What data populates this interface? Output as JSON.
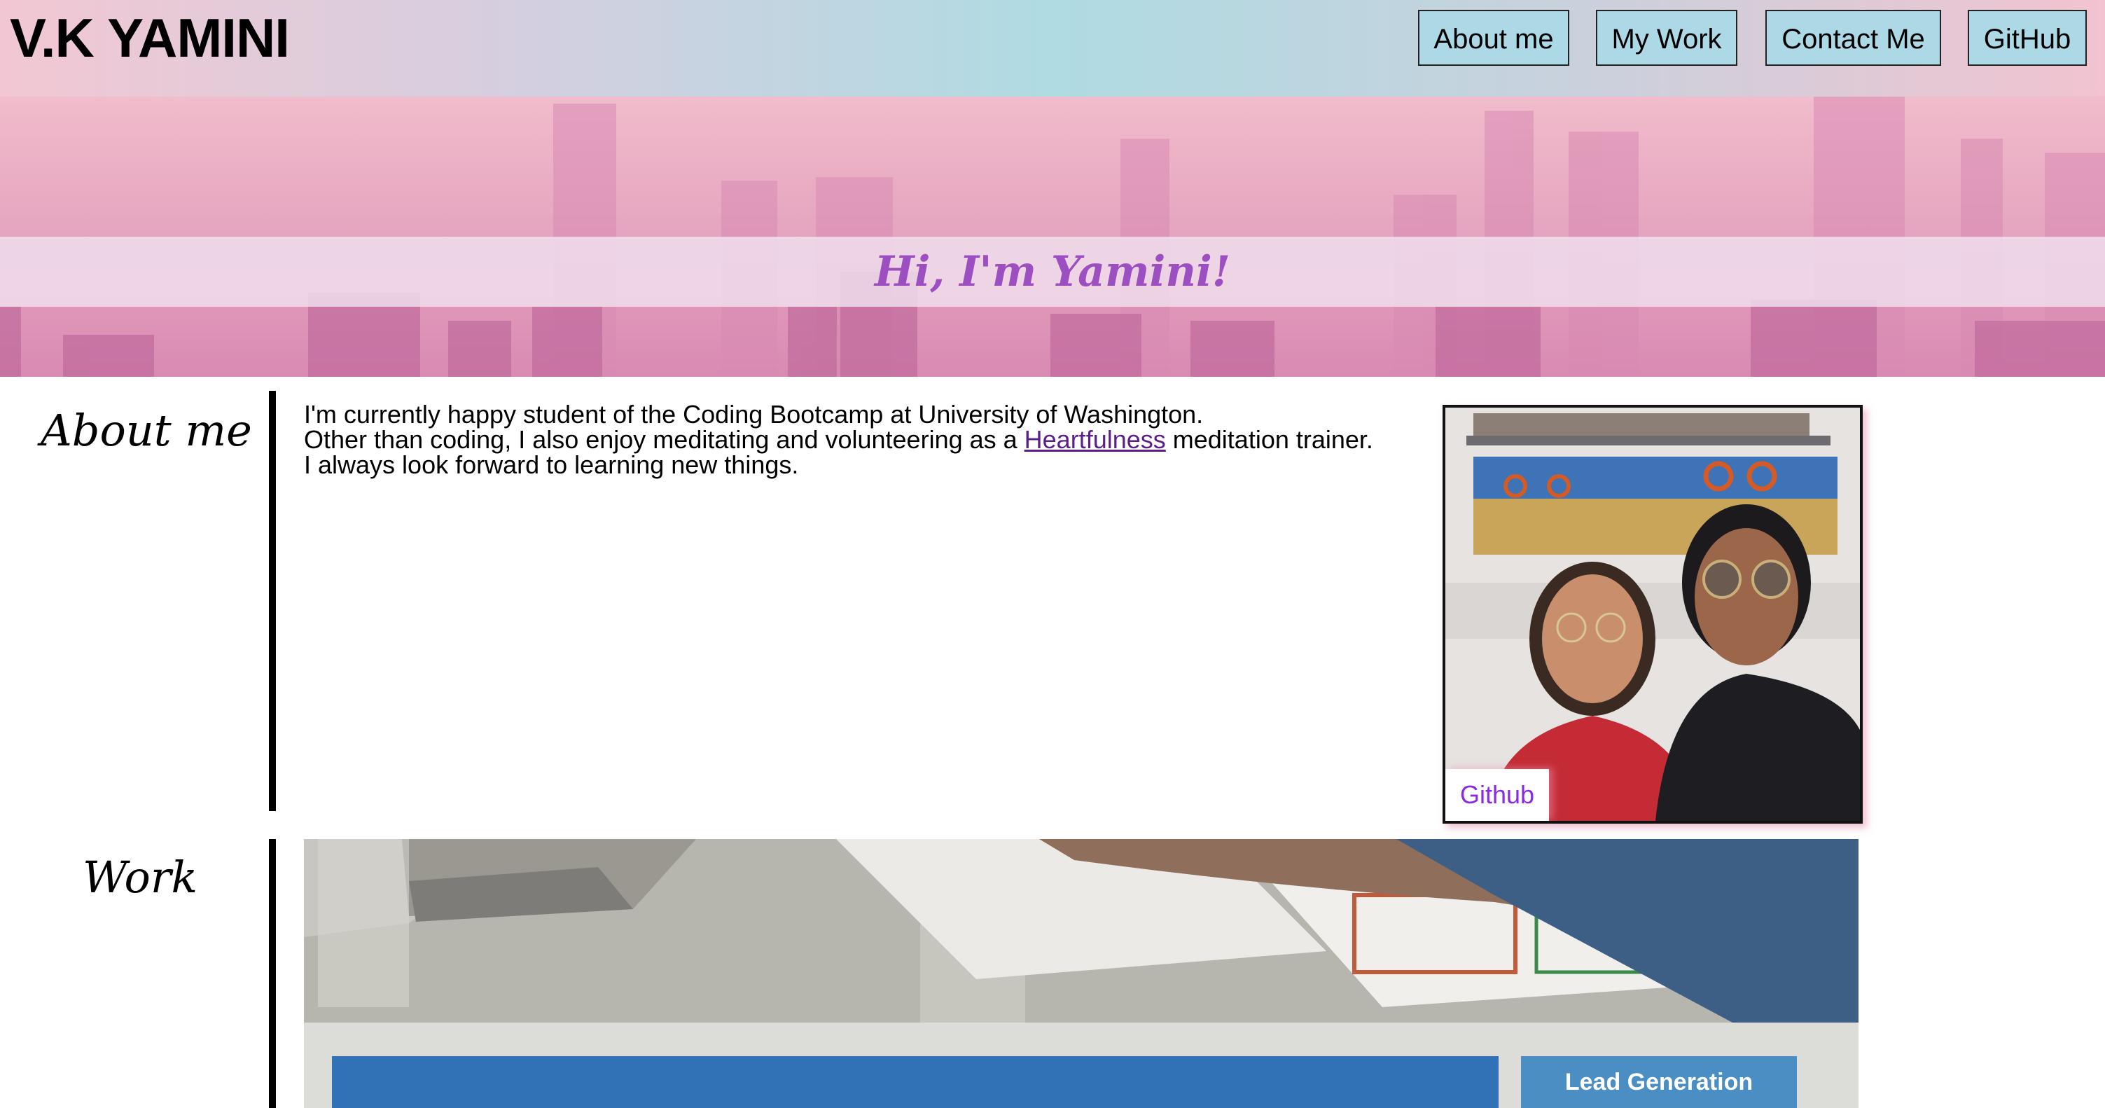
{
  "header": {
    "brand": "V.K YAMINI",
    "nav": [
      "About me",
      "My Work",
      "Contact Me",
      "GitHub"
    ]
  },
  "hero": {
    "title": "Hi, I'm Yamini!"
  },
  "about": {
    "label": "About me",
    "line1": "I'm currently happy student of the Coding Bootcamp at University of Washington.",
    "line2_before": "Other than coding, I also enjoy meditating and volunteering as a ",
    "line2_link": "Heartfulness",
    "line2_after": " meditation trainer.",
    "line3": "I always look forward to learning new things.",
    "photo_button": "Github"
  },
  "work": {
    "label": "Work",
    "preview_button": "Lead Generation"
  },
  "colors": {
    "nav_button_bg": "#add8e6",
    "hero_text": "#9b4fc0",
    "link": "#5a1f8a",
    "photo_button_text": "#8a2be2",
    "work_blue": "#3171b6"
  }
}
